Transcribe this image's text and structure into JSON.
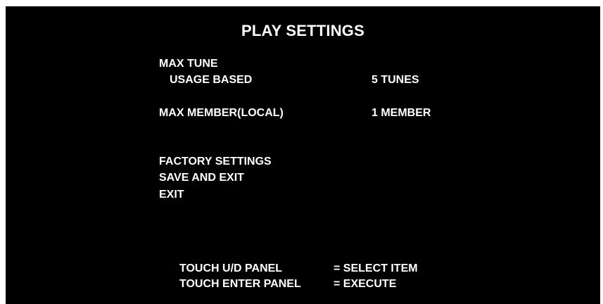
{
  "title": "PLAY SETTINGS",
  "settings": {
    "max_tune": {
      "group_label": "MAX TUNE",
      "sub_label": "USAGE BASED",
      "value": "5 TUNES"
    },
    "max_member": {
      "label": "MAX MEMBER(LOCAL)",
      "value": "1 MEMBER"
    }
  },
  "menu": {
    "factory_settings": "FACTORY SETTINGS",
    "save_and_exit": "SAVE AND EXIT",
    "exit": "EXIT"
  },
  "instructions": [
    {
      "control": "TOUCH U/D PANEL",
      "action": "= SELECT ITEM"
    },
    {
      "control": "TOUCH ENTER PANEL",
      "action": "= EXECUTE"
    }
  ]
}
